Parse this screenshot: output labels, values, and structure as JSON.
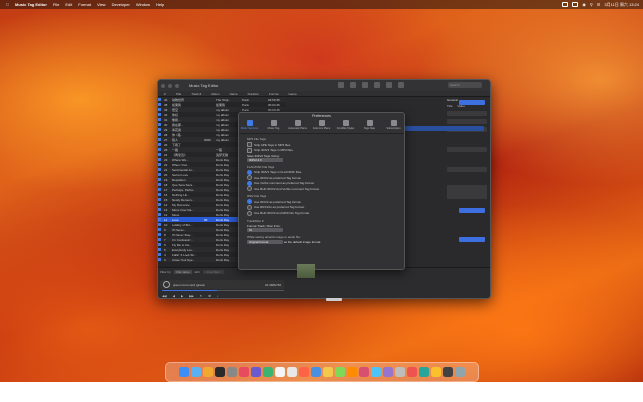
{
  "menubar": {
    "app": "Music Tag Editor",
    "items": [
      "File",
      "Edit",
      "Format",
      "View",
      "Developer",
      "Window",
      "Help"
    ],
    "clock": "3月11日 周六 13:24"
  },
  "window": {
    "title": "Music Tag Editor",
    "search_placeholder": "Search"
  },
  "toolbar2": [
    "#",
    "Title",
    "Track #",
    "Album",
    "Name",
    "Duration",
    "Format",
    "Genre"
  ],
  "filelist": {
    "rows": [
      {
        "n": "40",
        "t": "动物世界",
        "tr": "",
        "al": "The Origi...",
        "nm": "Punk",
        "d": "",
        "f": "02:50:35"
      },
      {
        "n": "38",
        "t": "如果我",
        "tr": "",
        "al": "如果我",
        "nm": "Punk",
        "d": "",
        "f": "00:04:46"
      },
      {
        "n": "33",
        "t": "悟空",
        "tr": "",
        "al": "my album",
        "nm": "Punk",
        "d": "",
        "f": "00:04:45"
      },
      {
        "n": "32",
        "t": "你好",
        "tr": "",
        "al": "my album",
        "nm": "",
        "d": "",
        "f": ""
      },
      {
        "n": "31",
        "t": "像我...",
        "tr": "",
        "al": "my album",
        "nm": "",
        "d": "",
        "f": ""
      },
      {
        "n": "30",
        "t": "我在那...",
        "tr": "",
        "al": "my album",
        "nm": "",
        "d": "",
        "f": ""
      },
      {
        "n": "29",
        "t": "青花瓷",
        "tr": "",
        "al": "my album",
        "nm": "",
        "d": "",
        "f": ""
      },
      {
        "n": "28",
        "t": "你 / 路...",
        "tr": "",
        "al": "my album",
        "nm": "",
        "d": "",
        "f": ""
      },
      {
        "n": "27",
        "t": "别人",
        "tr": "0009",
        "al": "my album",
        "nm": "",
        "d": "",
        "f": ""
      },
      {
        "n": "26",
        "t": "下雨了",
        "tr": "",
        "al": "",
        "nm": "",
        "d": "",
        "f": ""
      },
      {
        "n": "25",
        "t": "一路",
        "tr": "",
        "al": "一路",
        "nm": "",
        "d": "",
        "f": ""
      },
      {
        "n": "24",
        "t": "《再靠近》",
        "tr": "",
        "al": "追梦无疆",
        "nm": "",
        "d": "",
        "f": ""
      },
      {
        "n": "23",
        "t": "Where We...",
        "tr": "",
        "al": "Doris Day",
        "nm": "",
        "d": "",
        "f": ""
      },
      {
        "n": "22",
        "t": "When I Fal...",
        "tr": "",
        "al": "Doris Day",
        "nm": "",
        "d": "",
        "f": ""
      },
      {
        "n": "21",
        "t": "Sentimental Jo...",
        "tr": "",
        "al": "Doris Day",
        "nm": "",
        "d": "",
        "f": ""
      },
      {
        "n": "20",
        "t": "Secret Love",
        "tr": "",
        "al": "Doris Day",
        "nm": "",
        "d": "",
        "f": ""
      },
      {
        "n": "19",
        "t": "Repetition",
        "tr": "",
        "al": "Doris Day",
        "nm": "",
        "d": "",
        "f": ""
      },
      {
        "n": "18",
        "t": "Que Sera Sera...",
        "tr": "",
        "al": "Doris Day",
        "nm": "",
        "d": "",
        "f": ""
      },
      {
        "n": "17",
        "t": "Perhaps, Perha...",
        "tr": "",
        "al": "Doris Day",
        "nm": "",
        "d": "",
        "f": ""
      },
      {
        "n": "16",
        "t": "Nothing Lik...",
        "tr": "",
        "al": "Doris Day",
        "nm": "",
        "d": "",
        "f": ""
      },
      {
        "n": "15",
        "t": "Newly Remem...",
        "tr": "",
        "al": "Doris Day",
        "nm": "",
        "d": "",
        "f": ""
      },
      {
        "n": "14",
        "t": "My Romance",
        "tr": "",
        "al": "Doris Day",
        "nm": "",
        "d": "",
        "f": ""
      },
      {
        "n": "13",
        "t": "Move Over Da...",
        "tr": "",
        "al": "Doris Day",
        "nm": "",
        "d": "",
        "f": ""
      },
      {
        "n": "12",
        "t": "Move",
        "tr": "",
        "al": "Doris Day",
        "nm": "",
        "d": "",
        "f": ""
      },
      {
        "n": "11",
        "t": "Love",
        "tr": "00",
        "al": "Doris Day",
        "nm": "",
        "d": "",
        "f": ""
      },
      {
        "n": "10",
        "t": "Lullaby of Bro...",
        "tr": "",
        "al": "Doris Day",
        "nm": "",
        "d": "",
        "f": ""
      },
      {
        "n": "9",
        "t": "I'll Never...",
        "tr": "",
        "al": "Doris Day",
        "nm": "",
        "d": "",
        "f": ""
      },
      {
        "n": "8",
        "t": "I'll Never Stay...",
        "tr": "",
        "al": "Doris Day",
        "nm": "",
        "d": "",
        "f": ""
      },
      {
        "n": "7",
        "t": "I'm Confessin'...",
        "tr": "",
        "al": "Doris Day",
        "nm": "",
        "d": "",
        "f": ""
      },
      {
        "n": "6",
        "t": "Fly Me to the...",
        "tr": "",
        "al": "Doris Day",
        "nm": "",
        "d": "",
        "f": ""
      },
      {
        "n": "5",
        "t": "Everybody Lov...",
        "tr": "",
        "al": "Doris Day",
        "nm": "",
        "d": "",
        "f": ""
      },
      {
        "n": "4",
        "t": "Fallin' It Look Sti...",
        "tr": "",
        "al": "Doris Day",
        "nm": "",
        "d": "",
        "f": ""
      },
      {
        "n": "3",
        "t": "Close Your Eye...",
        "tr": "",
        "al": "Doris Day",
        "nm": "",
        "d": "",
        "f": ""
      }
    ],
    "selected_index": 24
  },
  "rightpane": {
    "header": "General",
    "edit_btn": "Edit Tag",
    "fields": [
      "Title",
      "Value"
    ]
  },
  "bottombar": {
    "filter_label": "Filter by:",
    "filter_field": "File name",
    "filter_with": "with",
    "filter_placeholder": "Input filter",
    "now_playing": "green room.mp3 (great)",
    "elapsed": "01:48/02:50",
    "progress": 0.45
  },
  "prefs": {
    "title": "Preferences",
    "tabs": [
      {
        "label": "Music Services",
        "active": true
      },
      {
        "label": "Music Tag",
        "active": false
      },
      {
        "label": "Automatic Plans",
        "active": false
      },
      {
        "label": "Columns Plans",
        "active": false
      },
      {
        "label": "Credible Styles",
        "active": false
      },
      {
        "label": "Tags Map",
        "active": false
      },
      {
        "label": "Subscription",
        "active": false
      }
    ],
    "mp3_heading": "MP3 File Tags",
    "mp3_opts": [
      {
        "label": "Strip APE Tags in MP3 files.",
        "on": false
      },
      {
        "label": "Strip ID3V1 Tags in MP3 files.",
        "on": false
      }
    ],
    "save_label": "Save ID3V2 Tags Using:",
    "save_value": "ID3V2.4.0",
    "flac_heading": "FLAC/DSF File Tags",
    "flac_opts": [
      {
        "label": "Strip ID3V1 Tags in FLAC/DSF files.",
        "on": true
      },
      {
        "label": "Use ID3V2 as preferred Tag format.",
        "on": false
      },
      {
        "label": "Use Vorbis comment as preferred Tag format.",
        "on": true
      },
      {
        "label": "Use Both ID3V2 And Vorbis comment Tag format.",
        "on": false
      }
    ],
    "wav_heading": "WAV File Tags",
    "wav_opts": [
      {
        "label": "Use ID3V2 as preferred Tag format.",
        "on": true
      },
      {
        "label": "Use RIFFInfo as preferred Tag format.",
        "on": false
      },
      {
        "label": "Use Both ID3V2 And RIFFInfo Tag format.",
        "on": false
      }
    ],
    "track_heading": "Track/Disc #",
    "track_label": "Format Track / Disc # As:",
    "track_value": "01",
    "art_heading": "While saving artwork image to audio file:",
    "art_value": "Original Format",
    "art_suffix": "as the default image format."
  }
}
